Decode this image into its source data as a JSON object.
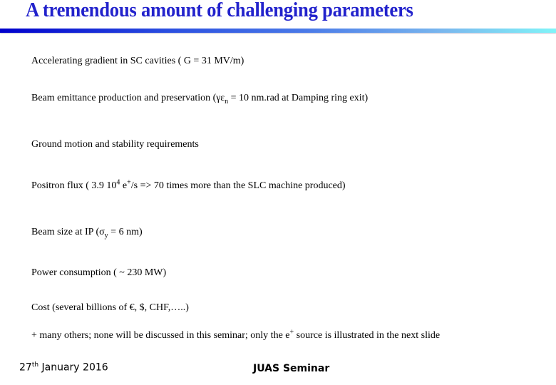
{
  "slide": {
    "title": "A tremendous amount of challenging parameters",
    "colors": {
      "title": "#2222cc",
      "bar_start": "#0000cc",
      "bar_end": "#80f4f8"
    },
    "items": [
      {
        "text": "Accelerating gradient in SC cavities  ( G = 31 MV/m)"
      },
      {
        "pre": "Beam emittance production and preservation  (γε",
        "sub": "n",
        "post": " = 10 nm.rad at Damping ring exit)"
      },
      {
        "text": "Ground motion and stability requirements"
      },
      {
        "pre": "Positron flux ( 3.9 10",
        "sup1": "4",
        "mid": " e",
        "sup2": "+",
        "post": "/s  => 70 times more than the SLC machine produced)"
      },
      {
        "pre": "Beam size at IP   (σ",
        "sub": "y",
        "post": " = 6 nm)"
      },
      {
        "text": "Power consumption  ( ~ 230 MW)"
      },
      {
        "text": "Cost  (several billions of €, $, CHF,…..)"
      },
      {
        "pre": "+ many others; none will be discussed in this seminar; only the e",
        "sup": "+",
        "post": " source is illustrated in the next slide"
      }
    ],
    "footer": {
      "date_day": "27",
      "date_suffix": "th",
      "date_rest": " January 2016",
      "center": "JUAS Seminar"
    }
  }
}
